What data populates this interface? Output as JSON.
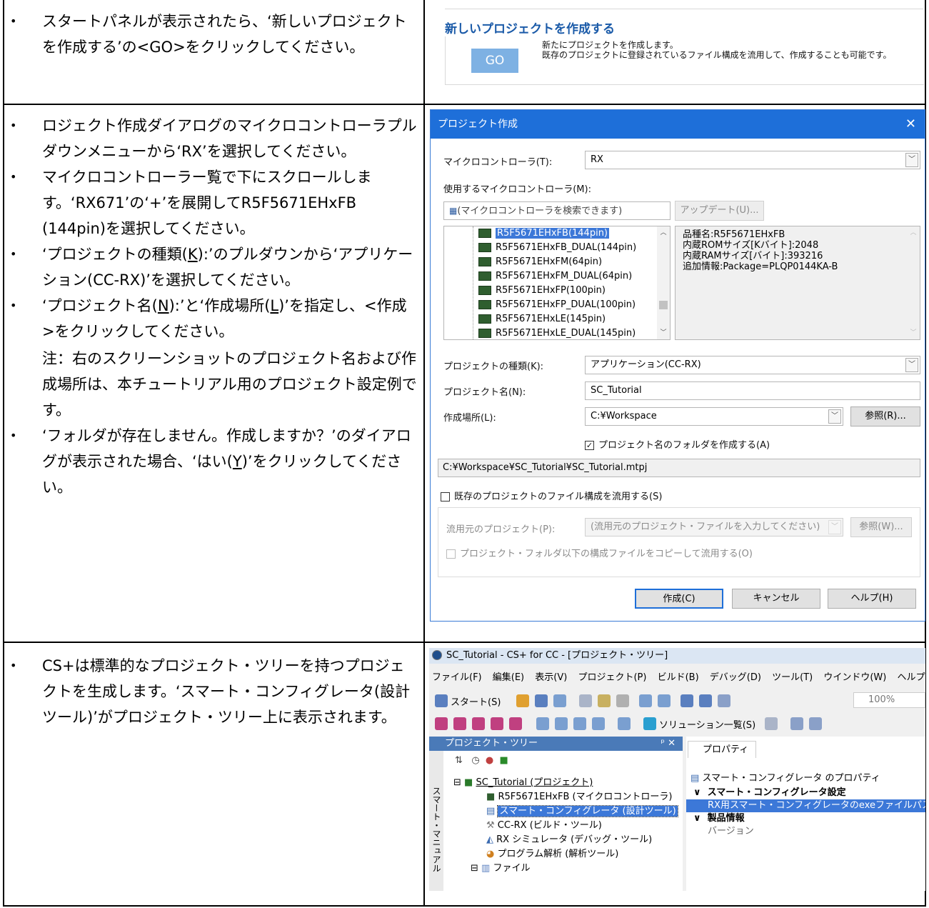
{
  "row1": {
    "left_items": [
      "スタートパネルが表示されたら、‘新しいプロジェクトを作成する’の<GO>をクリックしてください。"
    ],
    "panel": {
      "title": "新しいプロジェクトを作成する",
      "go_label": "GO",
      "desc_line1": "新たにプロジェクトを作成します。",
      "desc_line2": "既存のプロジェクトに登録されているファイル構成を流用して、作成することも可能です。"
    }
  },
  "row2": {
    "items": {
      "i1": "ロジェクト作成ダイアログのマイクロコントローラプルダウンメニューから‘RX’を選択してください。",
      "i2": "マイクロコントローラー覧で下にスクロールします。‘RX671’の‘+’を展開してR5F5671EHxFB (144pin)を選択してください。",
      "i3a": "‘プロジェクトの種類(",
      "i3k": "K",
      "i3b": "):’のプルダウンから‘アプリケーション(CC-RX)’を選択してください。",
      "i4a": "‘プロジェクト名(",
      "i4n": "N",
      "i4b": "):’と‘作成場所(",
      "i4l": "L",
      "i4c": ")’を指定し、<作成>をクリックしてください。",
      "note": "注：右のスクリーンショットのプロジェクト名および作成場所は、本チュートリアル用のプロジェクト設定例です。",
      "i5a": "‘フォルダが存在しません。作成しますか？’のダイアログが表示された場合、‘はい(",
      "i5y": "Y",
      "i5b": ")’をクリックしてください。"
    },
    "dialog": {
      "title": "プロジェクト作成",
      "close": "✕",
      "mcu_label": "マイクロコントローラ(T):",
      "mcu_value": "RX",
      "mcu_list_label": "使用するマイクロコントローラ(M):",
      "search_placeholder": "(マイクロコントローラを検索できます)",
      "update_button": "アップデート(U)...",
      "mcu_items": [
        "R5F5671EHxFB(144pin)",
        "R5F5671EHxFB_DUAL(144pin)",
        "R5F5671EHxFM(64pin)",
        "R5F5671EHxFM_DUAL(64pin)",
        "R5F5671EHxFP(100pin)",
        "R5F5671EHxFP_DUAL(100pin)",
        "R5F5671EHxLE(145pin)",
        "R5F5671EHxLE_DUAL(145pin)"
      ],
      "info_lines": [
        "品種名:R5F5671EHxFB",
        "内蔵ROMサイズ[Kバイト]:2048",
        "内蔵RAMサイズ[バイト]:393216",
        "追加情報:Package=PLQP0144KA-B"
      ],
      "type_label": "プロジェクトの種類(K):",
      "type_value": "アプリケーション(CC-RX)",
      "name_label": "プロジェクト名(N):",
      "name_value": "SC_Tutorial",
      "loc_label": "作成場所(L):",
      "loc_value": "C:¥Workspace",
      "browse_button": "参照(R)...",
      "create_folder_check": "プロジェクト名のフォルダを作成する(A)",
      "path_value": "C:¥Workspace¥SC_Tutorial¥SC_Tutorial.mtpj",
      "reuse_check": "既存のプロジェクトのファイル構成を流用する(S)",
      "src_label": "流用元のプロジェクト(P):",
      "src_placeholder": "(流用元のプロジェクト・ファイルを入力してください)",
      "browse2_button": "参照(W)...",
      "copy_check": "プロジェクト・フォルダ以下の構成ファイルをコピーして流用する(O)",
      "create_button": "作成(C)",
      "cancel_button": "キャンセル",
      "help_button": "ヘルプ(H)"
    }
  },
  "row3": {
    "left_items": [
      "CS+は標準的なプロジェクト・ツリーを持つプロジェクトを生成します。‘スマート・コンフィグレータ(設計ツール)’がプロジェクト・ツリー上に表示されます。"
    ],
    "ide": {
      "title": "SC_Tutorial - CS+ for CC - [プロジェクト・ツリー]",
      "menu": [
        "ファイル(F)",
        "編集(E)",
        "表示(V)",
        "プロジェクト(P)",
        "ビルド(B)",
        "デバッグ(D)",
        "ツール(T)",
        "ウインドウ(W)",
        "ヘルプ(H)"
      ],
      "start_button": "スタート(S)",
      "zoom": "100%",
      "solution_button": "ソリューション一覧(S)",
      "tree_pane_title": "プロジェクト・ツリー",
      "pin": "ᵖ ✕",
      "side_tab": "スマート・マニュアル",
      "tree_items": [
        "SC_Tutorial (プロジェクト)",
        "R5F5671EHxFB (マイクロコントローラ)",
        "スマート・コンフィグレータ (設計ツール)",
        "CC-RX (ビルド・ツール)",
        "RX シミュレータ (デバッグ・ツール)",
        "プログラム解析 (解析ツール)",
        "ファイル"
      ],
      "prop_tab": "プロパティ",
      "prop_header": "スマート・コンフィグレータ のプロパティ",
      "prop_cat1": "スマート・コンフィグレータ設定",
      "prop_sel": "RX用スマート・コンフィグレータのexeファイルパス",
      "prop_cat2": "製品情報",
      "prop_item2": "バージョン"
    }
  }
}
